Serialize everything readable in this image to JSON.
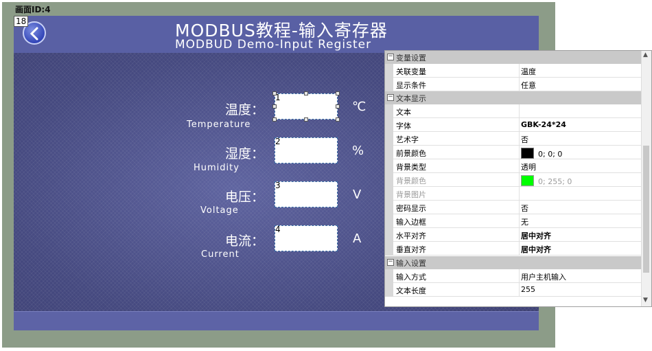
{
  "canvas": {
    "label": "画面ID:4"
  },
  "screen": {
    "back_button_id": "18",
    "title_cn": "MODBUS教程-输入寄存器",
    "title_en": "MODBUD Demo-Input Register",
    "rows": [
      {
        "label_cn": "温度：",
        "label_en": "Temperature",
        "input_id": "1",
        "unit": "℃"
      },
      {
        "label_cn": "湿度：",
        "label_en": "Humidity",
        "input_id": "2",
        "unit": "%"
      },
      {
        "label_cn": "电压：",
        "label_en": "Voltage",
        "input_id": "3",
        "unit": "V"
      },
      {
        "label_cn": "电流：",
        "label_en": "Current",
        "input_id": "4",
        "unit": "A"
      }
    ]
  },
  "properties": {
    "sections": [
      {
        "title": "变量设置",
        "rows": [
          {
            "key": "关联变量",
            "value": "温度"
          },
          {
            "key": "显示条件",
            "value": "任意"
          }
        ]
      },
      {
        "title": "文本显示",
        "rows": [
          {
            "key": "文本",
            "value": ""
          },
          {
            "key": "字体",
            "value": "GBK-24*24"
          },
          {
            "key": "艺术字",
            "value": "否"
          },
          {
            "key": "前景颜色",
            "value": "0; 0; 0",
            "color": "#000000"
          },
          {
            "key": "背景类型",
            "value": "透明"
          },
          {
            "key": "背景颜色",
            "value": "0; 255; 0",
            "color": "#00ff00"
          },
          {
            "key": "背景图片",
            "value": ""
          },
          {
            "key": "密码显示",
            "value": "否"
          },
          {
            "key": "输入边框",
            "value": "无"
          },
          {
            "key": "水平对齐",
            "value": "居中对齐"
          },
          {
            "key": "垂直对齐",
            "value": "居中对齐"
          }
        ]
      },
      {
        "title": "输入设置",
        "rows": [
          {
            "key": "输入方式",
            "value": "用户主机输入"
          },
          {
            "key": "文本长度",
            "value": "255"
          }
        ]
      }
    ]
  },
  "colors": {
    "screen_bg": "#43477e",
    "header_bg": "#5960a4",
    "frame_bg": "#8c9c88",
    "accent": "#3346b8"
  }
}
